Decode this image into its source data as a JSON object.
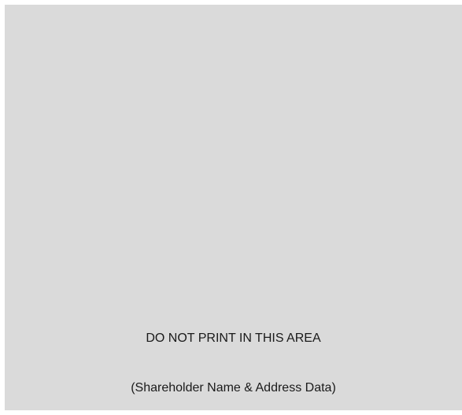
{
  "reserved_area": {
    "notice": "DO NOT PRINT IN THIS AREA",
    "caption": "(Shareholder Name & Address Data)"
  },
  "colors": {
    "area_background": "#dadada",
    "text": "#1a1a1a"
  }
}
